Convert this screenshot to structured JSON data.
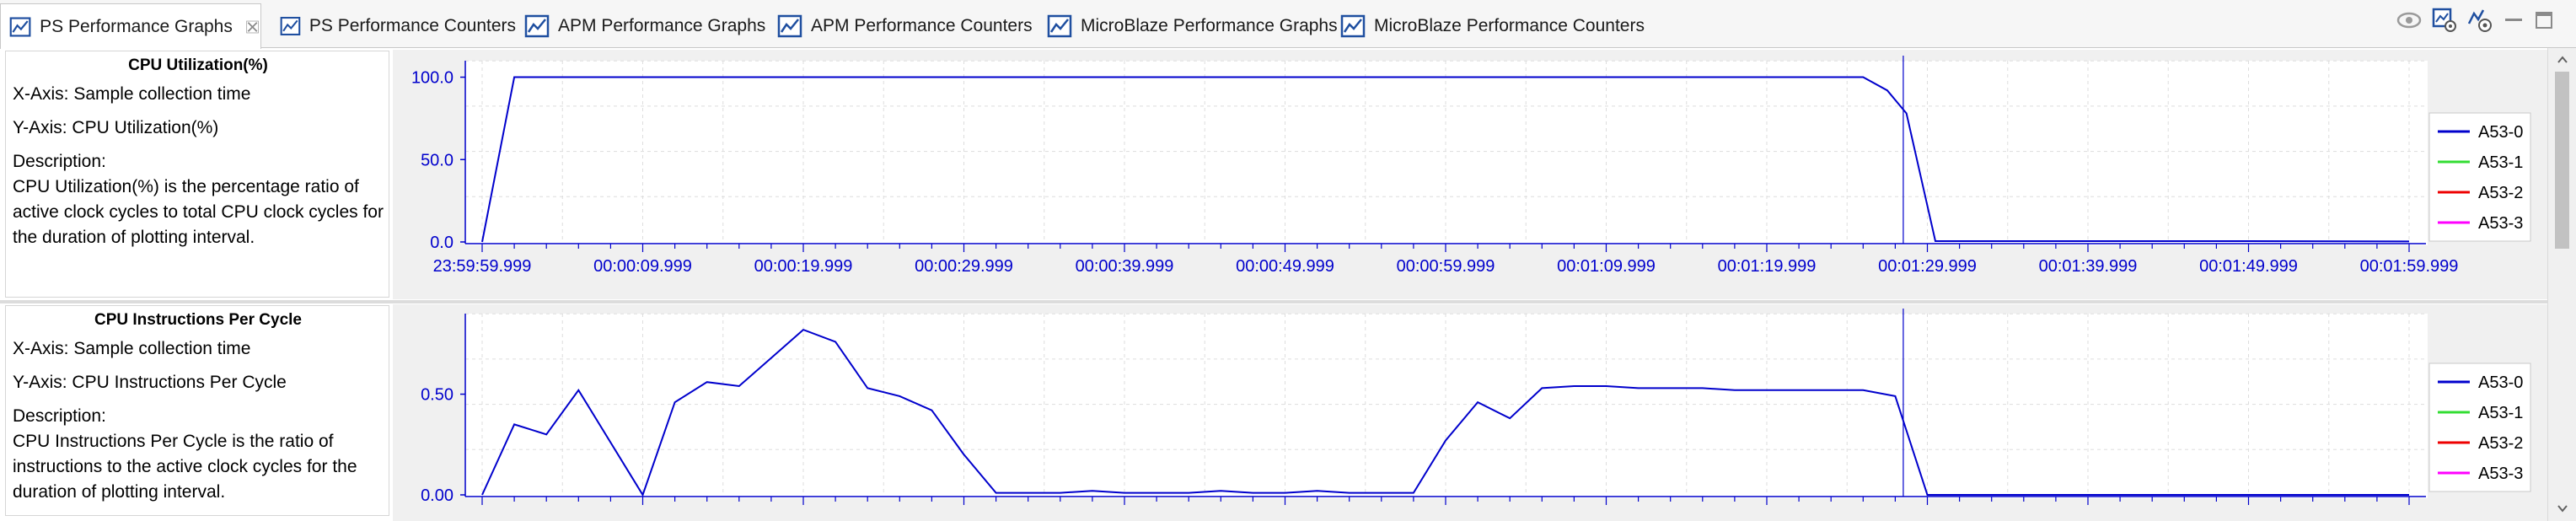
{
  "tabs": [
    {
      "label": "PS Performance Graphs",
      "active": true
    },
    {
      "label": "PS Performance Counters",
      "active": false
    },
    {
      "label": "APM Performance Graphs",
      "active": false
    },
    {
      "label": "APM Performance Counters",
      "active": false
    },
    {
      "label": "MicroBlaze Performance Graphs",
      "active": false
    },
    {
      "label": "MicroBlaze Performance Counters",
      "active": false
    }
  ],
  "toolbar": [
    "eye-icon",
    "settings-chart-icon",
    "graph-settings-icon",
    "minimize-icon",
    "maximize-icon"
  ],
  "panels": [
    {
      "title": "CPU Utilization(%)",
      "xaxis": "X-Axis: Sample collection time",
      "yaxis": "Y-Axis: CPU Utilization(%)",
      "desc_label": "Description:",
      "description": "CPU Utilization(%) is the percentage ratio of active clock cycles to total CPU clock cycles for the duration of plotting interval."
    },
    {
      "title": "CPU Instructions Per Cycle",
      "xaxis": "X-Axis: Sample collection time",
      "yaxis": "Y-Axis: CPU Instructions Per Cycle",
      "desc_label": "Description:",
      "description": "CPU Instructions Per Cycle is the ratio of instructions to the active clock cycles for the duration of plotting interval."
    }
  ],
  "legend": [
    {
      "name": "A53-0",
      "color": "#0000cc"
    },
    {
      "name": "A53-1",
      "color": "#33dd33"
    },
    {
      "name": "A53-2",
      "color": "#ee0000"
    },
    {
      "name": "A53-3",
      "color": "#ff00ff"
    }
  ],
  "chart_data": [
    {
      "type": "line",
      "title": "",
      "ylim": [
        0,
        110
      ],
      "yticks": [
        0.0,
        50.0,
        100.0
      ],
      "ytick_labels": [
        "0.0",
        "50.0",
        "100.0"
      ],
      "xticks": [
        "23:59:59.999",
        "00:00:09.999",
        "00:00:19.999",
        "00:00:29.999",
        "00:00:39.999",
        "00:00:49.999",
        "00:00:59.999",
        "00:01:09.999",
        "00:01:19.999",
        "00:01:29.999",
        "00:01:39.999",
        "00:01:49.999",
        "00:01:59.999"
      ],
      "x_seconds": [
        0,
        10,
        20,
        30,
        40,
        50,
        60,
        70,
        80,
        90,
        100,
        110,
        120
      ],
      "marker_x": 88.5,
      "grid": true,
      "legend_position": "right",
      "series": [
        {
          "name": "A53-0",
          "x": [
            0,
            2,
            4,
            10,
            20,
            30,
            40,
            50,
            60,
            70,
            80,
            85,
            86,
            87.5,
            88.7,
            90.5,
            100,
            110,
            120
          ],
          "y": [
            0,
            100,
            100,
            100,
            100,
            100,
            100,
            100,
            100,
            100,
            100,
            100,
            100,
            92,
            78,
            0.5,
            0.5,
            0.5,
            0.3
          ]
        },
        {
          "name": "A53-1",
          "x": [],
          "y": []
        },
        {
          "name": "A53-2",
          "x": [],
          "y": []
        },
        {
          "name": "A53-3",
          "x": [],
          "y": []
        }
      ]
    },
    {
      "type": "line",
      "title": "",
      "ylim": [
        0,
        0.9
      ],
      "yticks": [
        0.0,
        0.5
      ],
      "ytick_labels": [
        "0.00",
        "0.50"
      ],
      "grid": true,
      "legend_position": "right",
      "marker_x": 88.5,
      "series": [
        {
          "name": "A53-0",
          "x": [
            0,
            2,
            4,
            6,
            10,
            12,
            14,
            16,
            18,
            20,
            22,
            24,
            26,
            28,
            30,
            32,
            34,
            36,
            38,
            40,
            42,
            44,
            46,
            48,
            50,
            52,
            54,
            56,
            58,
            60,
            62,
            64,
            66,
            68,
            70,
            72,
            74,
            76,
            78,
            80,
            82,
            84,
            86,
            88,
            90,
            92,
            94,
            96,
            98,
            100,
            110,
            120
          ],
          "y": [
            0,
            0.35,
            0.3,
            0.52,
            0,
            0.46,
            0.56,
            0.54,
            0.68,
            0.82,
            0.76,
            0.53,
            0.49,
            0.42,
            0.2,
            0.01,
            0.01,
            0.01,
            0.02,
            0.01,
            0.01,
            0.01,
            0.02,
            0.01,
            0.01,
            0.02,
            0.01,
            0.01,
            0.01,
            0.27,
            0.46,
            0.38,
            0.53,
            0.54,
            0.54,
            0.53,
            0.53,
            0.53,
            0.52,
            0.52,
            0.52,
            0.52,
            0.52,
            0.49,
            0,
            0,
            0,
            0,
            0,
            0,
            0,
            0
          ]
        },
        {
          "name": "A53-1",
          "x": [],
          "y": []
        },
        {
          "name": "A53-2",
          "x": [],
          "y": []
        },
        {
          "name": "A53-3",
          "x": [],
          "y": []
        }
      ]
    }
  ]
}
